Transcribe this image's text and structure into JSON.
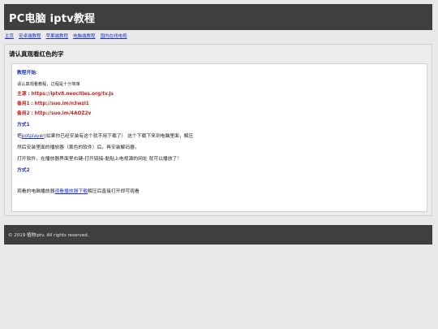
{
  "header": {
    "title": "PC电脑 iptv教程"
  },
  "nav": {
    "items": [
      "主页",
      "安卓端教程",
      "苹果端教程",
      "电脑端教程",
      "国内在线电视"
    ]
  },
  "panel": {
    "title": "请认真观看红色的字"
  },
  "content": {
    "tutorial_start_label": "教程开始",
    "colon": ":",
    "intro": "请认真观看教程，过程是十分简单",
    "main_source_label": "主源",
    "main_source_value": "https://iptv8.neocities.org/tv.js",
    "backup_source_label": "备用1",
    "backup_source_value": "http://suo.im/n3wzl1",
    "backup_source2_label": "备用2",
    "backup_source2_value": "http://suo.im/4AOZ2v",
    "method1_label": "方式1",
    "method1_prefix": "把",
    "method1_link": "potplayer",
    "method1_suffix": "(如果你已经安装有这个就不用下载了） 这个下载下来到电脑里面，解压",
    "method1_line2": "然后安装里面的播放器（黄色的软件）后，再安装解码器，",
    "method1_line3": "打开软件，在播放器界面里右键-打开链接-黏贴上电视源的网址 就可以播放了！",
    "method2_label": "方式2",
    "method2_prefix": "观看的电脑播放器",
    "method2_link": "观看播放器下载",
    "method2_suffix": "解压后直接打开即可观看"
  },
  "footer": {
    "text": "© 2019 植物iptv. All rights reserved."
  }
}
